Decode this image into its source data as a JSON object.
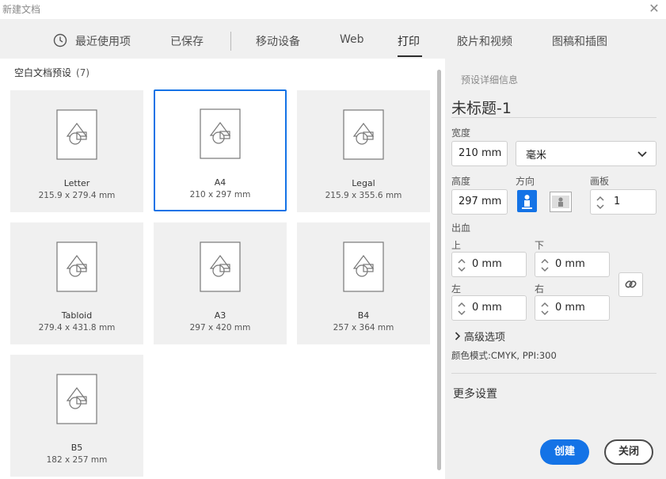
{
  "window": {
    "title": "新建文档",
    "close_icon": "close-icon"
  },
  "tabs": [
    {
      "label": "最近使用项",
      "icon": "clock-icon"
    },
    {
      "label": "已保存"
    },
    {
      "label": "移动设备"
    },
    {
      "label": "Web"
    },
    {
      "label": "打印",
      "active": true
    },
    {
      "label": "胶片和视频"
    },
    {
      "label": "图稿和插图"
    }
  ],
  "presets": {
    "title": "空白文档预设",
    "count": "(7)",
    "items": [
      {
        "name": "Letter",
        "size": "215.9 x 279.4 mm"
      },
      {
        "name": "A4",
        "size": "210 x 297 mm",
        "selected": true
      },
      {
        "name": "Legal",
        "size": "215.9 x 355.6 mm"
      },
      {
        "name": "Tabloid",
        "size": "279.4 x 431.8 mm"
      },
      {
        "name": "A3",
        "size": "297 x 420 mm"
      },
      {
        "name": "B4",
        "size": "257 x 364 mm"
      },
      {
        "name": "B5",
        "size": "182 x 257 mm"
      }
    ]
  },
  "details": {
    "header": "预设详细信息",
    "doc_title": "未标题-1",
    "width_label": "宽度",
    "width_value": "210 mm",
    "unit_value": "毫米",
    "height_label": "高度",
    "height_value": "297 mm",
    "orientation_label": "方向",
    "artboard_label": "画板",
    "artboard_value": "1",
    "bleed_label": "出血",
    "top_label": "上",
    "top_value": "0 mm",
    "bottom_label": "下",
    "bottom_value": "0 mm",
    "left_label": "左",
    "left_value": "0 mm",
    "right_label": "右",
    "right_value": "0 mm",
    "advanced_label": "高级选项",
    "color_mode": "颜色模式:CMYK, PPI:300",
    "more_settings": "更多设置",
    "create_label": "创建",
    "close_label": "关闭"
  },
  "colors": {
    "accent": "#1473e6",
    "panel": "#f0f0f0",
    "card": "#f0f0f0"
  }
}
